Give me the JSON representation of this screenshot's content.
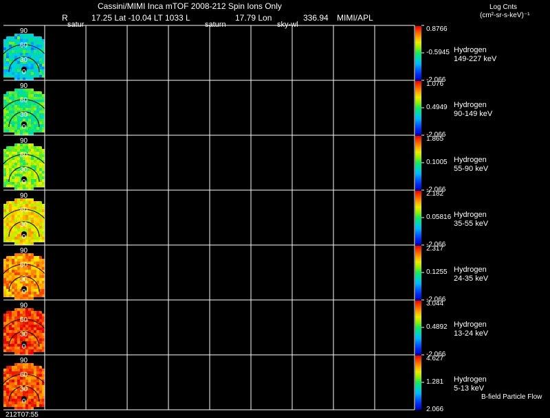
{
  "header": {
    "title": "Cassini/MIMI Inca mTOF  2008-212   Spin    Ions Only",
    "line2": {
      "r_label": "R",
      "lat_label": "17.25 Lat -10.04 LT 1033 L",
      "lon_label": "17.79 Lon",
      "lon_value": "336.94",
      "credit": "MIMI/APL"
    },
    "row3": [
      "satur",
      "saturn",
      "sky-wl"
    ],
    "units_title": "Log Cnts",
    "units": "(cm²-sr-s-keV)⁻¹"
  },
  "footer": {
    "time": "212T07:55",
    "bfield": "B-field Particle Flow"
  },
  "chart_data": {
    "type": "heatmap",
    "layout": "stacked spin-image panels with shared colorbar per panel",
    "colormap": "rainbow (blue-low to red-high)",
    "grid": true,
    "grid_color": "#ffffff",
    "thumbnail_contour_labels": [
      "90",
      "60",
      "30",
      "0"
    ],
    "panels": [
      {
        "species": "Hydrogen",
        "energy": "149-227 keV",
        "cmax": "0.8766",
        "cmid": "-0.5945",
        "cmin": "-2.066",
        "level": 0.4
      },
      {
        "species": "Hydrogen",
        "energy": "90-149 keV",
        "cmax": "1.076",
        "cmid": "0.4949",
        "cmin": "-2.066",
        "level": 0.5
      },
      {
        "species": "Hydrogen",
        "energy": "55-90 keV",
        "cmax": "1.865",
        "cmid": "0.1005",
        "cmin": "-2.066",
        "level": 0.6
      },
      {
        "species": "Hydrogen",
        "energy": "35-55 keV",
        "cmax": "2.182",
        "cmid": "0.05816",
        "cmin": "-2.066",
        "level": 0.72
      },
      {
        "species": "Hydrogen",
        "energy": "24-35 keV",
        "cmax": "2.317",
        "cmid": "0.1255",
        "cmin": "-2.066",
        "level": 0.82
      },
      {
        "species": "Hydrogen",
        "energy": "13-24 keV",
        "cmax": "3.044",
        "cmid": "0.4892",
        "cmin": "-2.066",
        "level": 0.92
      },
      {
        "species": "Hydrogen",
        "energy": "5-13 keV",
        "cmax": "4.627",
        "cmid": "1.281",
        "cmin": "2.066",
        "level": 0.9
      }
    ]
  }
}
